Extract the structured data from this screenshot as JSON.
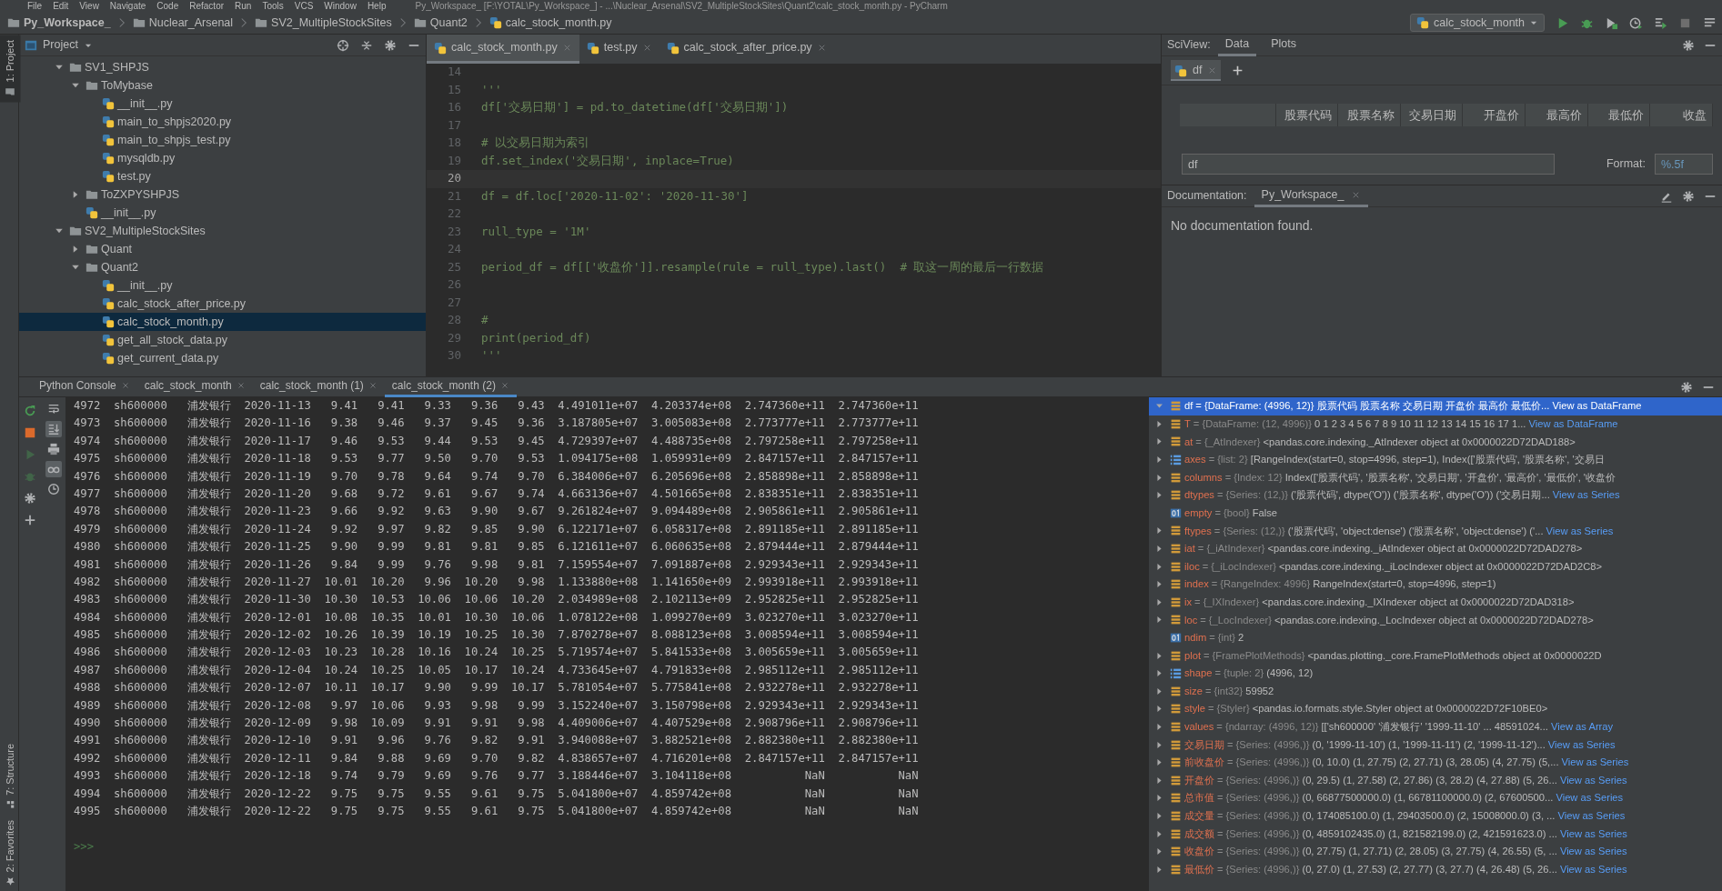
{
  "menu": [
    "File",
    "Edit",
    "View",
    "Navigate",
    "Code",
    "Refactor",
    "Run",
    "Tools",
    "VCS",
    "Window",
    "Help"
  ],
  "window": {
    "title": "Py_Workspace_ [F:\\YOTAL\\Py_Workspace_] - ...\\Nuclear_Arsenal\\SV2_MultipleStockSites\\Quant2\\calc_stock_month.py - PyCharm"
  },
  "breadcrumbs": [
    {
      "label": "Py_Workspace_",
      "kind": "project"
    },
    {
      "label": "Nuclear_Arsenal",
      "kind": "folder"
    },
    {
      "label": "SV2_MultipleStockSites",
      "kind": "folder"
    },
    {
      "label": "Quant2",
      "kind": "folder"
    },
    {
      "label": "calc_stock_month.py",
      "kind": "file"
    }
  ],
  "run_config": {
    "label": "calc_stock_month"
  },
  "left_stripe": {
    "top": [
      {
        "label": "1: Project",
        "selected": true
      }
    ],
    "bottom": [
      {
        "label": "7: Structure",
        "kind": "structure",
        "selected": false
      },
      {
        "label": "2: Favorites",
        "kind": "favorites",
        "selected": false
      }
    ]
  },
  "project": {
    "title": "Project",
    "tree": [
      {
        "label": "SV1_SHPJS",
        "kind": "folder",
        "expanded": true,
        "selected": false,
        "children": [
          {
            "label": "ToMybase",
            "kind": "folder",
            "expanded": true,
            "selected": false,
            "children": [
              {
                "label": "__init__.py",
                "kind": "file",
                "selected": false
              },
              {
                "label": "main_to_shpjs2020.py",
                "kind": "file",
                "selected": false
              },
              {
                "label": "main_to_shpjs_test.py",
                "kind": "file",
                "selected": false
              },
              {
                "label": "mysqldb.py",
                "kind": "file",
                "selected": false
              },
              {
                "label": "test.py",
                "kind": "file",
                "selected": false
              }
            ]
          },
          {
            "label": "ToZXPYSHPJS",
            "kind": "folder",
            "expanded": false,
            "selected": false
          },
          {
            "label": "__init__.py",
            "kind": "file",
            "selected": false
          }
        ]
      },
      {
        "label": "SV2_MultipleStockSites",
        "kind": "folder",
        "expanded": true,
        "selected": false,
        "children": [
          {
            "label": "Quant",
            "kind": "folder",
            "expanded": false,
            "selected": false
          },
          {
            "label": "Quant2",
            "kind": "folder",
            "expanded": true,
            "selected": false,
            "children": [
              {
                "label": "__init__.py",
                "kind": "file",
                "selected": false
              },
              {
                "label": "calc_stock_after_price.py",
                "kind": "file",
                "selected": false
              },
              {
                "label": "calc_stock_month.py",
                "kind": "file",
                "selected": true
              },
              {
                "label": "get_all_stock_data.py",
                "kind": "file",
                "selected": false
              },
              {
                "label": "get_current_data.py",
                "kind": "file",
                "selected": false
              }
            ]
          }
        ]
      }
    ]
  },
  "editor": {
    "tabs": [
      {
        "label": "calc_stock_month.py",
        "selected": true
      },
      {
        "label": "test.py",
        "selected": false
      },
      {
        "label": "calc_stock_after_price.py",
        "selected": false
      }
    ],
    "lines": [
      {
        "number": "14",
        "current": false
      },
      {
        "number": "15",
        "text": "'''",
        "current": false
      },
      {
        "number": "16",
        "text": "df['交易日期'] = pd.to_datetime(df['交易日期'])",
        "current": false
      },
      {
        "number": "17",
        "current": false
      },
      {
        "number": "18",
        "text": "# 以交易日期为索引",
        "current": false
      },
      {
        "number": "19",
        "text": "df.set_index('交易日期', inplace=True)",
        "current": false
      },
      {
        "number": "20",
        "current": true
      },
      {
        "number": "21",
        "text": "df = df.loc['2020-11-02': '2020-11-30']",
        "current": false
      },
      {
        "number": "22",
        "current": false
      },
      {
        "number": "23",
        "text": "rull_type = '1M'",
        "current": false
      },
      {
        "number": "24",
        "current": false
      },
      {
        "number": "25",
        "text": "period_df = df[['收盘价']].resample(rule = rull_type).last()  # 取这一周的最后一行数据",
        "current": false
      },
      {
        "number": "26",
        "current": false
      },
      {
        "number": "27",
        "current": false
      },
      {
        "number": "28",
        "text": "#",
        "current": false
      },
      {
        "number": "29",
        "text": "print(period_df)",
        "current": false
      },
      {
        "number": "30",
        "text": "'''",
        "current": false
      }
    ]
  },
  "sciview": {
    "title": "SciView:",
    "tabs": [
      {
        "label": "Data",
        "selected": true
      },
      {
        "label": "Plots",
        "selected": false
      }
    ],
    "data_tabs": [
      {
        "label": "df",
        "selected": true
      }
    ],
    "columns": [
      "股票代码",
      "股票名称",
      "交易日期",
      "开盘价",
      "最高价",
      "最低价",
      "收盘"
    ],
    "expression": "df",
    "format_label": "Format:",
    "format": "%.5f"
  },
  "documentation": {
    "title": "Documentation:",
    "tabs": [
      {
        "label": "Py_Workspace_",
        "selected": true
      }
    ],
    "message": "No documentation found."
  },
  "console": {
    "tabs": [
      {
        "label": "Python Console",
        "selected": false
      },
      {
        "label": "calc_stock_month",
        "selected": false
      },
      {
        "label": "calc_stock_month (1)",
        "selected": false
      },
      {
        "label": "calc_stock_month (2)",
        "selected": true
      }
    ],
    "actions": [
      {
        "kind": "rerun",
        "disabled": false
      },
      {
        "kind": "stop",
        "disabled": false
      },
      {
        "kind": "run",
        "disabled": true
      },
      {
        "kind": "debug",
        "disabled": true
      },
      {
        "kind": "settings",
        "disabled": false
      },
      {
        "kind": "add",
        "disabled": false
      }
    ],
    "toggles": [
      {
        "kind": "wrap",
        "on": false
      },
      {
        "kind": "scroll_end",
        "on": true
      },
      {
        "kind": "print",
        "on": false
      },
      {
        "kind": "variables",
        "on": true
      },
      {
        "kind": "history",
        "on": false
      }
    ],
    "rows": [
      [
        "4972",
        "sh600000",
        "浦发银行",
        "2020-11-13",
        "9.41",
        "9.41",
        "9.33",
        "9.36",
        "9.43",
        "4.491011e+07",
        "4.203374e+08",
        "2.747360e+11",
        "2.747360e+11"
      ],
      [
        "4973",
        "sh600000",
        "浦发银行",
        "2020-11-16",
        "9.38",
        "9.46",
        "9.37",
        "9.45",
        "9.36",
        "3.187805e+07",
        "3.005083e+08",
        "2.773777e+11",
        "2.773777e+11"
      ],
      [
        "4974",
        "sh600000",
        "浦发银行",
        "2020-11-17",
        "9.46",
        "9.53",
        "9.44",
        "9.53",
        "9.45",
        "4.729397e+07",
        "4.488735e+08",
        "2.797258e+11",
        "2.797258e+11"
      ],
      [
        "4975",
        "sh600000",
        "浦发银行",
        "2020-11-18",
        "9.53",
        "9.77",
        "9.50",
        "9.70",
        "9.53",
        "1.094175e+08",
        "1.059931e+09",
        "2.847157e+11",
        "2.847157e+11"
      ],
      [
        "4976",
        "sh600000",
        "浦发银行",
        "2020-11-19",
        "9.70",
        "9.78",
        "9.64",
        "9.74",
        "9.70",
        "6.384006e+07",
        "6.205696e+08",
        "2.858898e+11",
        "2.858898e+11"
      ],
      [
        "4977",
        "sh600000",
        "浦发银行",
        "2020-11-20",
        "9.68",
        "9.72",
        "9.61",
        "9.67",
        "9.74",
        "4.663136e+07",
        "4.501665e+08",
        "2.838351e+11",
        "2.838351e+11"
      ],
      [
        "4978",
        "sh600000",
        "浦发银行",
        "2020-11-23",
        "9.66",
        "9.92",
        "9.63",
        "9.90",
        "9.67",
        "9.261824e+07",
        "9.094489e+08",
        "2.905861e+11",
        "2.905861e+11"
      ],
      [
        "4979",
        "sh600000",
        "浦发银行",
        "2020-11-24",
        "9.92",
        "9.97",
        "9.82",
        "9.85",
        "9.90",
        "6.122171e+07",
        "6.058317e+08",
        "2.891185e+11",
        "2.891185e+11"
      ],
      [
        "4980",
        "sh600000",
        "浦发银行",
        "2020-11-25",
        "9.90",
        "9.99",
        "9.81",
        "9.81",
        "9.85",
        "6.121611e+07",
        "6.060635e+08",
        "2.879444e+11",
        "2.879444e+11"
      ],
      [
        "4981",
        "sh600000",
        "浦发银行",
        "2020-11-26",
        "9.84",
        "9.99",
        "9.76",
        "9.98",
        "9.81",
        "7.159554e+07",
        "7.091887e+08",
        "2.929343e+11",
        "2.929343e+11"
      ],
      [
        "4982",
        "sh600000",
        "浦发银行",
        "2020-11-27",
        "10.01",
        "10.20",
        "9.96",
        "10.20",
        "9.98",
        "1.133880e+08",
        "1.141650e+09",
        "2.993918e+11",
        "2.993918e+11"
      ],
      [
        "4983",
        "sh600000",
        "浦发银行",
        "2020-11-30",
        "10.30",
        "10.53",
        "10.06",
        "10.06",
        "10.20",
        "2.034989e+08",
        "2.102113e+09",
        "2.952825e+11",
        "2.952825e+11"
      ],
      [
        "4984",
        "sh600000",
        "浦发银行",
        "2020-12-01",
        "10.08",
        "10.35",
        "10.01",
        "10.30",
        "10.06",
        "1.078122e+08",
        "1.099270e+09",
        "3.023270e+11",
        "3.023270e+11"
      ],
      [
        "4985",
        "sh600000",
        "浦发银行",
        "2020-12-02",
        "10.26",
        "10.39",
        "10.19",
        "10.25",
        "10.30",
        "7.870278e+07",
        "8.088123e+08",
        "3.008594e+11",
        "3.008594e+11"
      ],
      [
        "4986",
        "sh600000",
        "浦发银行",
        "2020-12-03",
        "10.23",
        "10.28",
        "10.16",
        "10.24",
        "10.25",
        "5.719574e+07",
        "5.841533e+08",
        "3.005659e+11",
        "3.005659e+11"
      ],
      [
        "4987",
        "sh600000",
        "浦发银行",
        "2020-12-04",
        "10.24",
        "10.25",
        "10.05",
        "10.17",
        "10.24",
        "4.733645e+07",
        "4.791833e+08",
        "2.985112e+11",
        "2.985112e+11"
      ],
      [
        "4988",
        "sh600000",
        "浦发银行",
        "2020-12-07",
        "10.11",
        "10.17",
        "9.90",
        "9.99",
        "10.17",
        "5.781054e+07",
        "5.775841e+08",
        "2.932278e+11",
        "2.932278e+11"
      ],
      [
        "4989",
        "sh600000",
        "浦发银行",
        "2020-12-08",
        "9.97",
        "10.06",
        "9.93",
        "9.98",
        "9.99",
        "3.152240e+07",
        "3.150798e+08",
        "2.929343e+11",
        "2.929343e+11"
      ],
      [
        "4990",
        "sh600000",
        "浦发银行",
        "2020-12-09",
        "9.98",
        "10.09",
        "9.91",
        "9.91",
        "9.98",
        "4.409006e+07",
        "4.407529e+08",
        "2.908796e+11",
        "2.908796e+11"
      ],
      [
        "4991",
        "sh600000",
        "浦发银行",
        "2020-12-10",
        "9.91",
        "9.96",
        "9.76",
        "9.82",
        "9.91",
        "3.940088e+07",
        "3.882521e+08",
        "2.882380e+11",
        "2.882380e+11"
      ],
      [
        "4992",
        "sh600000",
        "浦发银行",
        "2020-12-11",
        "9.84",
        "9.88",
        "9.69",
        "9.70",
        "9.82",
        "4.838657e+07",
        "4.716201e+08",
        "2.847157e+11",
        "2.847157e+11"
      ],
      [
        "4993",
        "sh600000",
        "浦发银行",
        "2020-12-18",
        "9.74",
        "9.79",
        "9.69",
        "9.76",
        "9.77",
        "3.188446e+07",
        "3.104118e+08",
        "NaN",
        "NaN"
      ],
      [
        "4994",
        "sh600000",
        "浦发银行",
        "2020-12-22",
        "9.75",
        "9.75",
        "9.55",
        "9.61",
        "9.75",
        "5.041800e+07",
        "4.859742e+08",
        "NaN",
        "NaN"
      ],
      [
        "4995",
        "sh600000",
        "浦发银行",
        "2020-12-22",
        "9.75",
        "9.75",
        "9.55",
        "9.61",
        "9.75",
        "5.041800e+07",
        "4.859742e+08",
        "NaN",
        "NaN"
      ]
    ],
    "prompt": ">>>"
  },
  "variables": [
    {
      "name": "df",
      "assign": "=",
      "type": "{DataFrame: (4996, 12)}",
      "value": "股票代码 股票名称 交易日期 开盘价 最高价 最低价...",
      "link": "View as DataFrame",
      "kind": "object",
      "expanded": true,
      "selected": true
    },
    {
      "name": "T",
      "assign": "=",
      "type": "{DataFrame: (12, 4996)}",
      "value": "0 1 2 3 4 5 6 7 8 9 10 11 12 13 14 15 16 17 1...",
      "link": "View as DataFrame",
      "kind": "object",
      "expanded": false,
      "selected": false
    },
    {
      "name": "at",
      "assign": "=",
      "type": "{_AtIndexer}",
      "value": "<pandas.core.indexing._AtIndexer object at 0x0000022D72DAD188>",
      "kind": "object",
      "expanded": false,
      "selected": false
    },
    {
      "name": "axes",
      "assign": "=",
      "type": "{list: 2}",
      "value": "[RangeIndex(start=0, stop=4996, step=1), Index(['股票代码', '股票名称', '交易日",
      "kind": "sequence",
      "expanded": false,
      "selected": false
    },
    {
      "name": "columns",
      "assign": "=",
      "type": "{Index: 12}",
      "value": "Index(['股票代码', '股票名称', '交易日期', '开盘价', '最高价', '最低价', '收盘价",
      "kind": "object",
      "expanded": false,
      "selected": false
    },
    {
      "name": "dtypes",
      "assign": "=",
      "type": "{Series: (12,)}",
      "value": "('股票代码', dtype('O')) ('股票名称', dtype('O')) ('交易日期...",
      "link": "View as Series",
      "kind": "object",
      "expanded": false,
      "selected": false
    },
    {
      "name": "empty",
      "assign": "=",
      "type": "{bool}",
      "value": "False",
      "kind": "scalar",
      "selected": false
    },
    {
      "name": "ftypes",
      "assign": "=",
      "type": "{Series: (12,)}",
      "value": "('股票代码', 'object:dense') ('股票名称', 'object:dense') ('...",
      "link": "View as Series",
      "kind": "object",
      "expanded": false,
      "selected": false
    },
    {
      "name": "iat",
      "assign": "=",
      "type": "{_iAtIndexer}",
      "value": "<pandas.core.indexing._iAtIndexer object at 0x0000022D72DAD278>",
      "kind": "object",
      "expanded": false,
      "selected": false
    },
    {
      "name": "iloc",
      "assign": "=",
      "type": "{_iLocIndexer}",
      "value": "<pandas.core.indexing._iLocIndexer object at 0x0000022D72DAD2C8>",
      "kind": "object",
      "expanded": false,
      "selected": false
    },
    {
      "name": "index",
      "assign": "=",
      "type": "{RangeIndex: 4996}",
      "value": "RangeIndex(start=0, stop=4996, step=1)",
      "kind": "object",
      "expanded": false,
      "selected": false
    },
    {
      "name": "ix",
      "assign": "=",
      "type": "{_IXIndexer}",
      "value": "<pandas.core.indexing._IXIndexer object at 0x0000022D72DAD318>",
      "kind": "object",
      "expanded": false,
      "selected": false
    },
    {
      "name": "loc",
      "assign": "=",
      "type": "{_LocIndexer}",
      "value": "<pandas.core.indexing._LocIndexer object at 0x0000022D72DAD278>",
      "kind": "object",
      "expanded": false,
      "selected": false
    },
    {
      "name": "ndim",
      "assign": "=",
      "type": "{int}",
      "value": "2",
      "kind": "scalar",
      "selected": false
    },
    {
      "name": "plot",
      "assign": "=",
      "type": "{FramePlotMethods}",
      "value": "<pandas.plotting._core.FramePlotMethods object at 0x0000022D",
      "kind": "object",
      "expanded": false,
      "selected": false
    },
    {
      "name": "shape",
      "assign": "=",
      "type": "{tuple: 2}",
      "value": "(4996, 12)",
      "kind": "sequence",
      "expanded": false,
      "selected": false
    },
    {
      "name": "size",
      "assign": "=",
      "type": "{int32}",
      "value": "59952",
      "kind": "object",
      "expanded": false,
      "selected": false
    },
    {
      "name": "style",
      "assign": "=",
      "type": "{Styler}",
      "value": "<pandas.io.formats.style.Styler object at 0x0000022D72F10BE0>",
      "kind": "object",
      "expanded": false,
      "selected": false
    },
    {
      "name": "values",
      "assign": "=",
      "type": "{ndarray: (4996, 12)}",
      "value": "[['sh600000' '浦发银行' '1999-11-10' ... 48591024...",
      "link": "View as Array",
      "kind": "object",
      "expanded": false,
      "selected": false
    },
    {
      "name": "交易日期",
      "assign": "=",
      "type": "{Series: (4996,)}",
      "value": "(0, '1999-11-10') (1, '1999-11-11') (2, '1999-11-12')...",
      "link": "View as Series",
      "kind": "object",
      "expanded": false,
      "selected": false
    },
    {
      "name": "前收盘价",
      "assign": "=",
      "type": "{Series: (4996,)}",
      "value": "(0, 10.0) (1, 27.75) (2, 27.71) (3, 28.05) (4, 27.75) (5,...",
      "link": "View as Series",
      "kind": "object",
      "expanded": false,
      "selected": false
    },
    {
      "name": "开盘价",
      "assign": "=",
      "type": "{Series: (4996,)}",
      "value": "(0, 29.5) (1, 27.58) (2, 27.86) (3, 28.2) (4, 27.88) (5, 26...",
      "link": "View as Series",
      "kind": "object",
      "expanded": false,
      "selected": false
    },
    {
      "name": "总市值",
      "assign": "=",
      "type": "{Series: (4996,)}",
      "value": "(0, 66877500000.0) (1, 66781100000.0) (2, 67600500...",
      "link": "View as Series",
      "kind": "object",
      "expanded": false,
      "selected": false
    },
    {
      "name": "成交量",
      "assign": "=",
      "type": "{Series: (4996,)}",
      "value": "(0, 174085100.0) (1, 29403500.0) (2, 15008000.0) (3, ...",
      "link": "View as Series",
      "kind": "object",
      "expanded": false,
      "selected": false
    },
    {
      "name": "成交额",
      "assign": "=",
      "type": "{Series: (4996,)}",
      "value": "(0, 4859102435.0) (1, 821582199.0) (2, 421591623.0) ...",
      "link": "View as Series",
      "kind": "object",
      "expanded": false,
      "selected": false
    },
    {
      "name": "收盘价",
      "assign": "=",
      "type": "{Series: (4996,)}",
      "value": "(0, 27.75) (1, 27.71) (2, 28.05) (3, 27.75) (4, 26.55) (5, ...",
      "link": "View as Series",
      "kind": "object",
      "expanded": false,
      "selected": false
    },
    {
      "name": "最低价",
      "assign": "=",
      "type": "{Series: (4996,)}",
      "value": "(0, 27.0) (1, 27.53) (2, 27.77) (3, 27.7) (4, 26.48) (5, 26...",
      "link": "View as Series",
      "kind": "object",
      "expanded": false,
      "selected": false
    }
  ]
}
